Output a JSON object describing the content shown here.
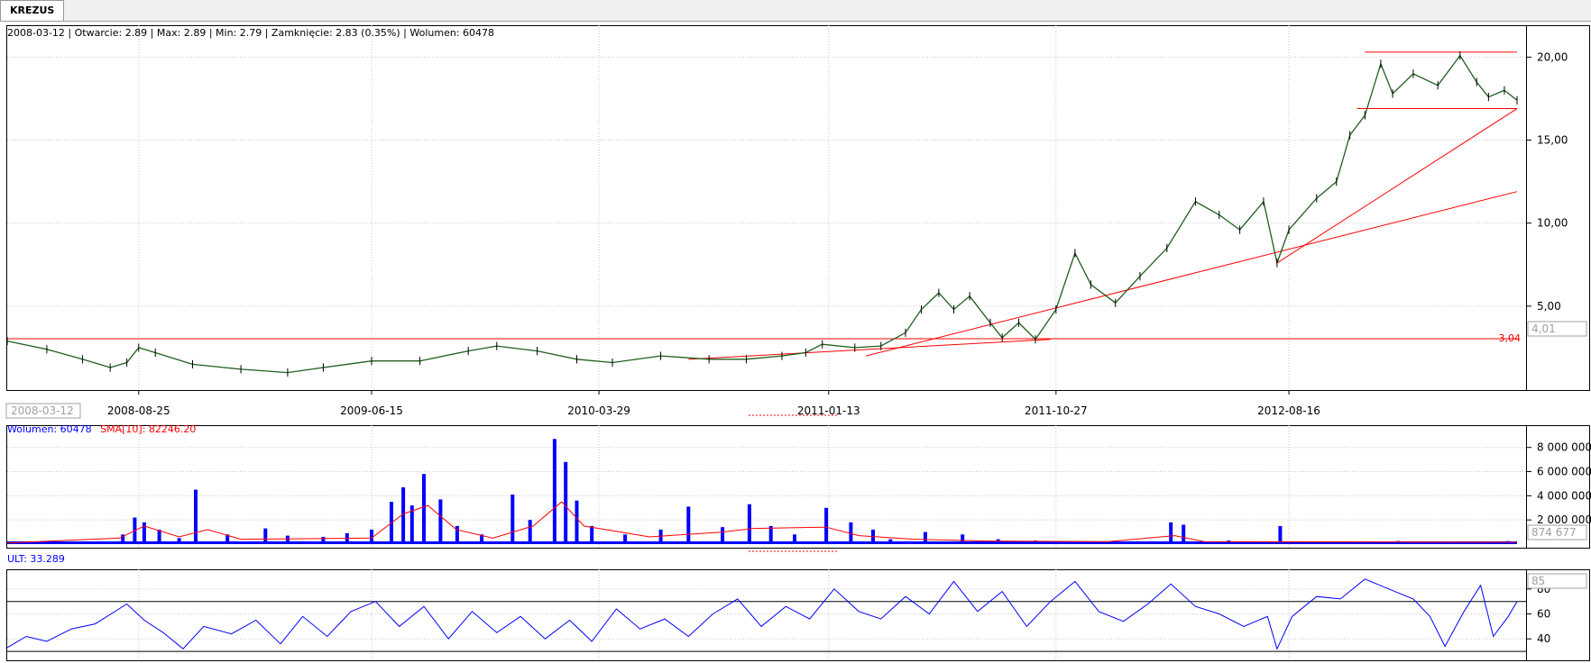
{
  "tab": {
    "label": "KREZUS"
  },
  "colors": {
    "price": "#1f5e1f",
    "volume": "#0000ff",
    "sma": "#ff0000",
    "ult": "#0000ff",
    "trend": "#ff0000",
    "grid": "#c8c8c8"
  },
  "header": {
    "info": "2008-03-12 | Otwarcie: 2.89 | Max: 2.89 | Min: 2.79 | Zamknięcie: 2.83 (0.35%)  | Wolumen: 60478"
  },
  "price_panel": {
    "cursor_date_label": "2008-03-12",
    "price_tag": "4,01",
    "level_label": "3,04"
  },
  "volume_panel": {
    "legend_volume": "Wolumen: 60478",
    "legend_sma": "SMA[10]: 82246.20",
    "value_tag": "874 677"
  },
  "ult_panel": {
    "legend": "ULT: 33.289",
    "value_tag": "85"
  },
  "chart_data": [
    {
      "type": "line",
      "name": "price",
      "x_tick_labels": [
        "2008-08-25",
        "2009-06-15",
        "2010-03-29",
        "2011-01-13",
        "2011-10-27",
        "2012-08-16"
      ],
      "y_tick_labels": [
        "5,00",
        "10,00",
        "15,00",
        "20,00"
      ],
      "ylim": [
        0,
        21
      ],
      "x_range": [
        "2008-03-12",
        "2013-05-31"
      ],
      "points": [
        [
          "2008-03-12",
          2.9
        ],
        [
          "2008-05-01",
          2.4
        ],
        [
          "2008-06-15",
          1.8
        ],
        [
          "2008-07-20",
          1.3
        ],
        [
          "2008-08-10",
          1.6
        ],
        [
          "2008-08-25",
          2.5
        ],
        [
          "2008-09-15",
          2.2
        ],
        [
          "2008-11-01",
          1.5
        ],
        [
          "2009-01-01",
          1.2
        ],
        [
          "2009-03-01",
          1.0
        ],
        [
          "2009-04-15",
          1.3
        ],
        [
          "2009-06-15",
          1.7
        ],
        [
          "2009-08-15",
          1.7
        ],
        [
          "2009-10-15",
          2.3
        ],
        [
          "2009-11-20",
          2.6
        ],
        [
          "2010-01-10",
          2.3
        ],
        [
          "2010-03-01",
          1.8
        ],
        [
          "2010-04-15",
          1.6
        ],
        [
          "2010-06-15",
          2.0
        ],
        [
          "2010-08-15",
          1.8
        ],
        [
          "2010-10-01",
          1.8
        ],
        [
          "2010-11-15",
          2.0
        ],
        [
          "2010-12-15",
          2.2
        ],
        [
          "2011-01-05",
          2.7
        ],
        [
          "2011-02-15",
          2.5
        ],
        [
          "2011-03-20",
          2.6
        ],
        [
          "2011-04-20",
          3.4
        ],
        [
          "2011-05-10",
          4.8
        ],
        [
          "2011-06-01",
          5.8
        ],
        [
          "2011-06-20",
          4.8
        ],
        [
          "2011-07-10",
          5.6
        ],
        [
          "2011-08-05",
          4.0
        ],
        [
          "2011-08-20",
          3.1
        ],
        [
          "2011-09-10",
          4.0
        ],
        [
          "2011-10-01",
          3.0
        ],
        [
          "2011-10-27",
          4.8
        ],
        [
          "2011-11-20",
          8.2
        ],
        [
          "2011-12-10",
          6.3
        ],
        [
          "2012-01-10",
          5.2
        ],
        [
          "2012-02-10",
          6.8
        ],
        [
          "2012-03-15",
          8.5
        ],
        [
          "2012-04-20",
          11.3
        ],
        [
          "2012-05-20",
          10.5
        ],
        [
          "2012-06-15",
          9.6
        ],
        [
          "2012-07-15",
          11.3
        ],
        [
          "2012-08-01",
          7.6
        ],
        [
          "2012-08-16",
          9.6
        ],
        [
          "2012-09-20",
          11.5
        ],
        [
          "2012-10-15",
          12.5
        ],
        [
          "2012-11-01",
          15.3
        ],
        [
          "2012-11-20",
          16.5
        ],
        [
          "2012-12-10",
          19.6
        ],
        [
          "2012-12-25",
          17.8
        ],
        [
          "2013-01-20",
          19.0
        ],
        [
          "2013-02-20",
          18.3
        ],
        [
          "2013-03-20",
          20.1
        ],
        [
          "2013-04-10",
          18.5
        ],
        [
          "2013-04-25",
          17.6
        ],
        [
          "2013-05-15",
          18.0
        ],
        [
          "2013-05-31",
          17.4
        ]
      ],
      "horizontal_lines": [
        3.04
      ],
      "trend_lines": [
        {
          "from": [
            "2011-03-01",
            2.0
          ],
          "to": [
            "2013-05-31",
            11.9
          ]
        },
        {
          "from": [
            "2012-08-01",
            7.6
          ],
          "to": [
            "2013-05-31",
            16.9
          ]
        },
        {
          "from": [
            "2012-11-20",
            20.3
          ],
          "to": [
            "2013-05-31",
            20.3
          ]
        },
        {
          "from": [
            "2012-11-10",
            16.9
          ],
          "to": [
            "2013-05-31",
            16.9
          ]
        },
        {
          "from": [
            "2010-07-20",
            1.8
          ],
          "to": [
            "2011-10-20",
            3.0
          ]
        }
      ]
    },
    {
      "type": "bar",
      "name": "volume",
      "y_tick_labels": [
        "2 000 000",
        "4 000 000",
        "6 000 000",
        "8 000 000"
      ],
      "ylim": [
        0,
        8500000
      ],
      "series": [
        {
          "name": "Wolumen",
          "points": [
            [
              "2008-03-20",
              200000
            ],
            [
              "2008-06-01",
              150000
            ],
            [
              "2008-08-05",
              800000
            ],
            [
              "2008-08-20",
              2200000
            ],
            [
              "2008-09-01",
              1800000
            ],
            [
              "2008-09-20",
              1200000
            ],
            [
              "2008-10-15",
              500000
            ],
            [
              "2008-11-05",
              4500000
            ],
            [
              "2008-12-15",
              800000
            ],
            [
              "2009-02-01",
              1300000
            ],
            [
              "2009-03-01",
              700000
            ],
            [
              "2009-04-15",
              600000
            ],
            [
              "2009-05-15",
              900000
            ],
            [
              "2009-06-15",
              1200000
            ],
            [
              "2009-07-10",
              3500000
            ],
            [
              "2009-07-25",
              4700000
            ],
            [
              "2009-08-05",
              3200000
            ],
            [
              "2009-08-20",
              5800000
            ],
            [
              "2009-09-10",
              3700000
            ],
            [
              "2009-10-01",
              1500000
            ],
            [
              "2009-11-01",
              800000
            ],
            [
              "2009-12-10",
              4100000
            ],
            [
              "2010-01-01",
              2000000
            ],
            [
              "2010-02-01",
              8700000
            ],
            [
              "2010-02-15",
              6800000
            ],
            [
              "2010-03-01",
              3600000
            ],
            [
              "2010-03-20",
              1500000
            ],
            [
              "2010-05-01",
              800000
            ],
            [
              "2010-06-15",
              1200000
            ],
            [
              "2010-07-20",
              3100000
            ],
            [
              "2010-09-01",
              1400000
            ],
            [
              "2010-10-05",
              3300000
            ],
            [
              "2010-11-01",
              1500000
            ],
            [
              "2010-12-01",
              800000
            ],
            [
              "2011-01-10",
              3000000
            ],
            [
              "2011-02-10",
              1800000
            ],
            [
              "2011-03-10",
              1200000
            ],
            [
              "2011-04-01",
              400000
            ],
            [
              "2011-05-15",
              1000000
            ],
            [
              "2011-07-01",
              800000
            ],
            [
              "2011-08-15",
              400000
            ],
            [
              "2011-10-01",
              300000
            ],
            [
              "2011-12-01",
              200000
            ],
            [
              "2012-02-01",
              200000
            ],
            [
              "2012-03-20",
              1800000
            ],
            [
              "2012-04-05",
              1600000
            ],
            [
              "2012-06-01",
              300000
            ],
            [
              "2012-08-05",
              1500000
            ],
            [
              "2012-10-01",
              200000
            ],
            [
              "2013-01-01",
              250000
            ],
            [
              "2013-05-20",
              250000
            ]
          ]
        },
        {
          "name": "SMA[10]",
          "points": [
            [
              "2008-03-12",
              100000
            ],
            [
              "2008-08-01",
              500000
            ],
            [
              "2008-09-01",
              1500000
            ],
            [
              "2008-10-15",
              600000
            ],
            [
              "2008-11-20",
              1200000
            ],
            [
              "2009-01-01",
              400000
            ],
            [
              "2009-06-15",
              500000
            ],
            [
              "2009-07-25",
              2500000
            ],
            [
              "2009-08-25",
              3200000
            ],
            [
              "2009-09-30",
              1200000
            ],
            [
              "2009-11-15",
              500000
            ],
            [
              "2010-01-05",
              1500000
            ],
            [
              "2010-02-10",
              3500000
            ],
            [
              "2010-03-10",
              1500000
            ],
            [
              "2010-06-01",
              600000
            ],
            [
              "2010-09-01",
              1000000
            ],
            [
              "2010-10-10",
              1300000
            ],
            [
              "2011-01-10",
              1400000
            ],
            [
              "2011-02-20",
              700000
            ],
            [
              "2011-05-01",
              400000
            ],
            [
              "2011-08-01",
              250000
            ],
            [
              "2012-01-01",
              200000
            ],
            [
              "2012-03-25",
              700000
            ],
            [
              "2012-05-01",
              200000
            ],
            [
              "2013-05-31",
              150000
            ]
          ]
        }
      ]
    },
    {
      "type": "line",
      "name": "ULT",
      "y_tick_labels": [
        "40",
        "60",
        "80"
      ],
      "ylim": [
        25,
        90
      ],
      "guide_levels": [
        30,
        70
      ],
      "points": [
        [
          "2008-03-12",
          33
        ],
        [
          "2008-04-05",
          42
        ],
        [
          "2008-05-01",
          38
        ],
        [
          "2008-06-01",
          48
        ],
        [
          "2008-07-01",
          52
        ],
        [
          "2008-08-10",
          68
        ],
        [
          "2008-09-01",
          55
        ],
        [
          "2008-09-25",
          45
        ],
        [
          "2008-10-20",
          32
        ],
        [
          "2008-11-15",
          50
        ],
        [
          "2008-12-20",
          44
        ],
        [
          "2009-01-20",
          55
        ],
        [
          "2009-02-20",
          36
        ],
        [
          "2009-03-20",
          58
        ],
        [
          "2009-04-20",
          42
        ],
        [
          "2009-05-20",
          62
        ],
        [
          "2009-06-20",
          70
        ],
        [
          "2009-07-20",
          50
        ],
        [
          "2009-08-20",
          66
        ],
        [
          "2009-09-20",
          40
        ],
        [
          "2009-10-20",
          62
        ],
        [
          "2009-11-20",
          45
        ],
        [
          "2009-12-20",
          58
        ],
        [
          "2010-01-20",
          40
        ],
        [
          "2010-02-20",
          55
        ],
        [
          "2010-03-20",
          38
        ],
        [
          "2010-04-20",
          64
        ],
        [
          "2010-05-20",
          48
        ],
        [
          "2010-06-20",
          56
        ],
        [
          "2010-07-20",
          42
        ],
        [
          "2010-08-20",
          60
        ],
        [
          "2010-09-20",
          72
        ],
        [
          "2010-10-20",
          50
        ],
        [
          "2010-11-20",
          66
        ],
        [
          "2010-12-20",
          56
        ],
        [
          "2011-01-20",
          80
        ],
        [
          "2011-02-20",
          62
        ],
        [
          "2011-03-20",
          56
        ],
        [
          "2011-04-20",
          74
        ],
        [
          "2011-05-20",
          60
        ],
        [
          "2011-06-20",
          86
        ],
        [
          "2011-07-20",
          62
        ],
        [
          "2011-08-20",
          78
        ],
        [
          "2011-09-20",
          50
        ],
        [
          "2011-10-20",
          70
        ],
        [
          "2011-11-20",
          86
        ],
        [
          "2011-12-20",
          62
        ],
        [
          "2012-01-20",
          54
        ],
        [
          "2012-02-20",
          68
        ],
        [
          "2012-03-20",
          84
        ],
        [
          "2012-04-20",
          66
        ],
        [
          "2012-05-20",
          60
        ],
        [
          "2012-06-20",
          50
        ],
        [
          "2012-07-20",
          58
        ],
        [
          "2012-08-01",
          32
        ],
        [
          "2012-08-20",
          58
        ],
        [
          "2012-09-20",
          74
        ],
        [
          "2012-10-20",
          72
        ],
        [
          "2012-11-20",
          88
        ],
        [
          "2012-12-20",
          80
        ],
        [
          "2013-01-20",
          72
        ],
        [
          "2013-02-10",
          58
        ],
        [
          "2013-03-01",
          34
        ],
        [
          "2013-03-25",
          62
        ],
        [
          "2013-04-15",
          83
        ],
        [
          "2013-05-01",
          42
        ],
        [
          "2013-05-20",
          58
        ],
        [
          "2013-05-31",
          70
        ]
      ]
    }
  ]
}
